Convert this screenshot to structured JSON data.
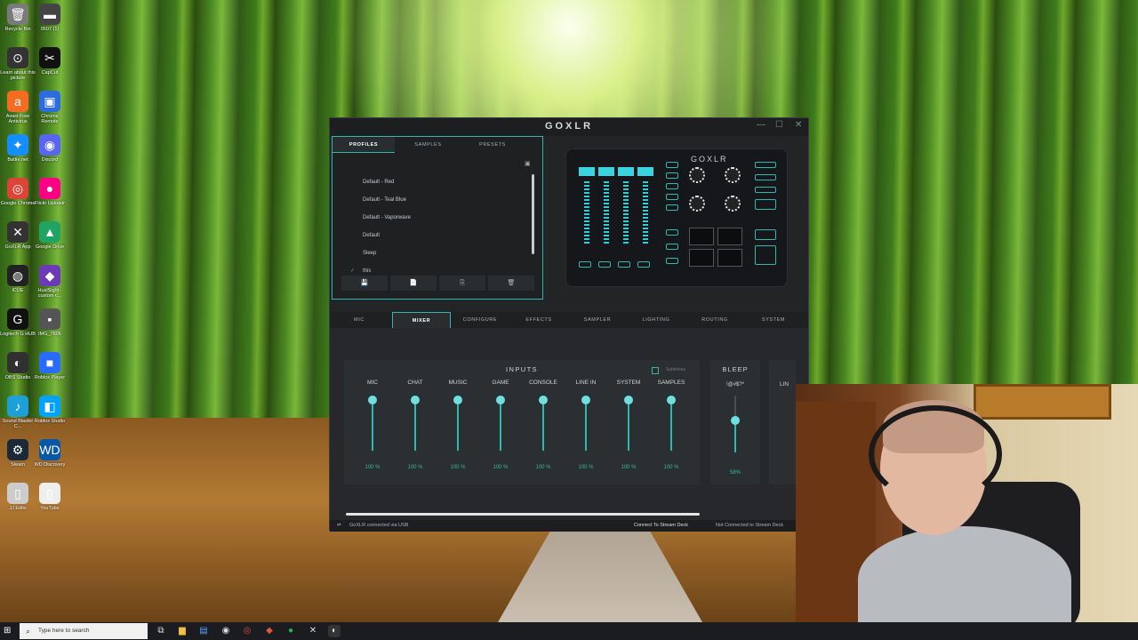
{
  "desktop": {
    "icons": [
      {
        "label": "Recycle Bin",
        "glyph": "🗑",
        "color": "#7a7a7a"
      },
      {
        "label": "0507 (1)",
        "glyph": "▬",
        "color": "#444444"
      },
      {
        "label": "Learn about this picture",
        "glyph": "⊙",
        "color": "#333333"
      },
      {
        "label": "CapCut",
        "glyph": "✂",
        "color": "#111111"
      },
      {
        "label": "Avast Free Antivirus",
        "glyph": "a",
        "color": "#f36c21"
      },
      {
        "label": "Chrome Remote",
        "glyph": "▣",
        "color": "#2d6cdf"
      },
      {
        "label": "Battle.net",
        "glyph": "✦",
        "color": "#148eff"
      },
      {
        "label": "Discord",
        "glyph": "◉",
        "color": "#5865f2"
      },
      {
        "label": "Google Chrome",
        "glyph": "◎",
        "color": "#db4437"
      },
      {
        "label": "Flickr Uploadr",
        "glyph": "●",
        "color": "#ff0084"
      },
      {
        "label": "GoXLR App",
        "glyph": "✕",
        "color": "#333333"
      },
      {
        "label": "Google Drive",
        "glyph": "▲",
        "color": "#1fa463"
      },
      {
        "label": "iCUE",
        "glyph": "◍",
        "color": "#222222"
      },
      {
        "label": "HuslSight - custom c...",
        "glyph": "◆",
        "color": "#6a3ab8"
      },
      {
        "label": "Logitech G HUB",
        "glyph": "G",
        "color": "#111111"
      },
      {
        "label": "IMG_7806",
        "glyph": "▪",
        "color": "#555555"
      },
      {
        "label": "OBS Studio",
        "glyph": "◐",
        "color": "#303030"
      },
      {
        "label": "Roblox Player",
        "glyph": "■",
        "color": "#2a6bff"
      },
      {
        "label": "Sound Blaster C...",
        "glyph": "♪",
        "color": "#1da0d8"
      },
      {
        "label": "Roblox Studio",
        "glyph": "◧",
        "color": "#00a2ff"
      },
      {
        "label": "Steam",
        "glyph": "⚙",
        "color": "#1b2838"
      },
      {
        "label": "WD Discovery",
        "glyph": "WD",
        "color": "#0a57a8"
      },
      {
        "label": "JJ Edits",
        "glyph": "▯",
        "color": "#cccccc"
      },
      {
        "label": "YouTube",
        "glyph": "▯",
        "color": "#eeeeee"
      }
    ]
  },
  "app": {
    "title": "GOXLR",
    "window_controls": [
      "—",
      "☐",
      "✕"
    ],
    "profile_tabs": [
      "PROFILES",
      "SAMPLES",
      "PRESETS"
    ],
    "active_profile_tab": "PROFILES",
    "profiles": [
      "Default - Red",
      "Default - Teal Blue",
      "Default - Vaporwave",
      "Default",
      "Sleep",
      "this"
    ],
    "selected_profile_check": "✓",
    "profile_buttons": [
      "💾",
      "📄",
      "⎘",
      "🗑"
    ],
    "device_logo": "GOXLR",
    "nav_tabs": [
      "MIC",
      "MIXER",
      "CONFIGURE",
      "EFFECTS",
      "SAMPLER",
      "LIGHTING",
      "ROUTING",
      "SYSTEM"
    ],
    "active_nav_tab": "MIXER",
    "inputs_title": "INPUTS",
    "submixes_label": "Submixes",
    "channels": [
      {
        "name": "MIC",
        "value": "100 %",
        "level": 1.0
      },
      {
        "name": "CHAT",
        "value": "100 %",
        "level": 1.0
      },
      {
        "name": "MUSIC",
        "value": "100 %",
        "level": 1.0
      },
      {
        "name": "GAME",
        "value": "100 %",
        "level": 1.0
      },
      {
        "name": "CONSOLE",
        "value": "100 %",
        "level": 1.0
      },
      {
        "name": "LINE IN",
        "value": "100 %",
        "level": 1.0
      },
      {
        "name": "SYSTEM",
        "value": "100 %",
        "level": 1.0
      },
      {
        "name": "SAMPLES",
        "value": "100 %",
        "level": 1.0
      }
    ],
    "bleep": {
      "title": "BLEEP",
      "label": "!@#$?*",
      "value": "58%",
      "level": 0.58
    },
    "line_partial": "LIN",
    "status_left": "GoXLR connected via USB",
    "status_connect": "Connect To Stream Deck",
    "status_right": "Not Connected to Stream Deck",
    "accent": "#2fb8b0"
  },
  "taskbar": {
    "search_placeholder": "Type here to search",
    "icons": [
      "task-view-icon",
      "file-explorer-icon",
      "store-icon",
      "steam-icon",
      "chrome-icon",
      "spotify-icon",
      "goxlr-icon",
      "obs-icon"
    ]
  }
}
